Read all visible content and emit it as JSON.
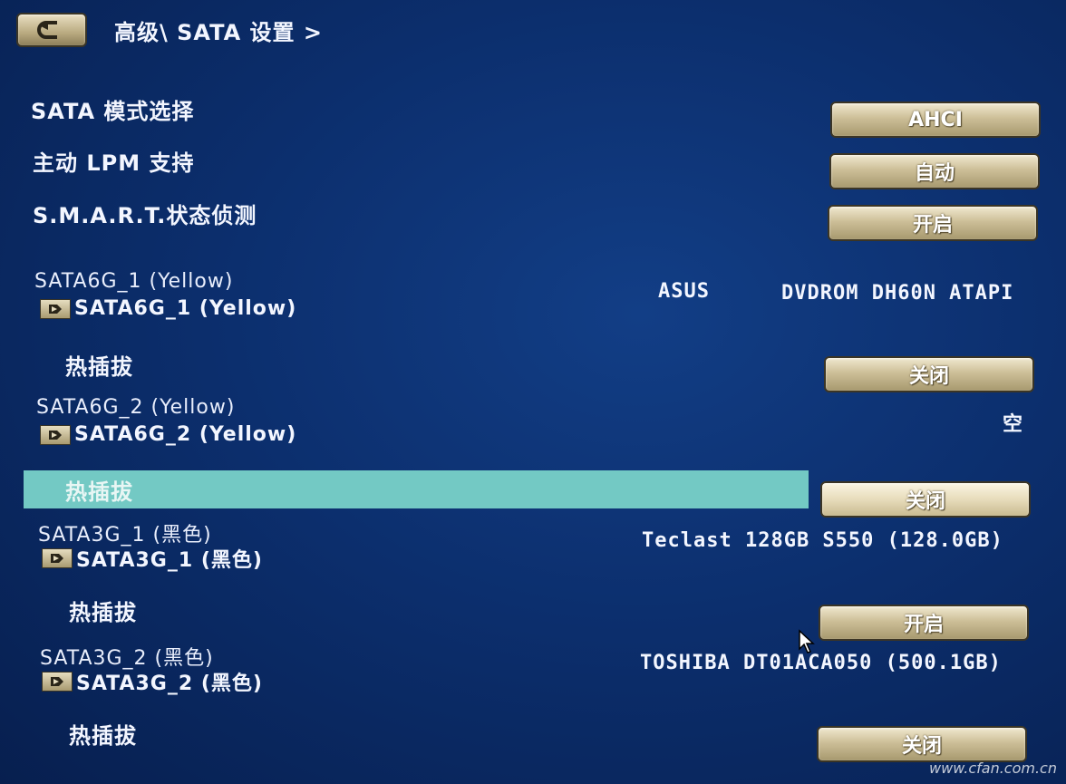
{
  "header": {
    "breadcrumb": "高级\\ SATA 设置 >"
  },
  "settings": [
    {
      "label": "SATA 模式选择",
      "value": "AHCI"
    },
    {
      "label": "主动 LPM 支持",
      "value": "自动"
    },
    {
      "label": "S.M.A.R.T.状态侦测",
      "value": "开启"
    }
  ],
  "ports": [
    {
      "name": "SATA6G_1 (Yellow)",
      "submenu": "SATA6G_1 (Yellow)",
      "device_vendor": "ASUS",
      "device_model": "DVDROM DH60N ATAPI",
      "hotplug_label": "热插拔",
      "hotplug_value": "关闭"
    },
    {
      "name": "SATA6G_2 (Yellow)",
      "submenu": "SATA6G_2 (Yellow)",
      "device": "空",
      "hotplug_label": "热插拔",
      "hotplug_value": "关闭"
    },
    {
      "name": "SATA3G_1 (黑色)",
      "submenu": "SATA3G_1 (黑色)",
      "device": "Teclast 128GB S550 (128.0GB)",
      "hotplug_label": "热插拔",
      "hotplug_value": "开启"
    },
    {
      "name": "SATA3G_2 (黑色)",
      "submenu": "SATA3G_2 (黑色)",
      "device": "TOSHIBA DT01ACA050 (500.1GB)",
      "hotplug_label": "热插拔",
      "hotplug_value": "关闭"
    }
  ],
  "watermark": "www.cfan.com.cn",
  "colors": {
    "background": "#0c2f6e",
    "highlight": "#73c9c4",
    "button": "#cdbf98"
  },
  "icons": {
    "back": "back-arrow-icon",
    "submenu": "submenu-arrow-icon",
    "cursor": "mouse-pointer-icon"
  }
}
